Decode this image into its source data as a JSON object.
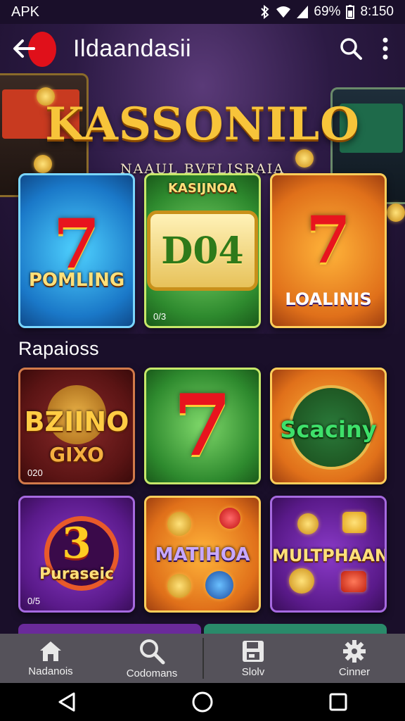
{
  "status_bar": {
    "left_text": "APK",
    "battery": "69%",
    "time": "8:150"
  },
  "app_bar": {
    "title": "Ildaandasii",
    "back_icon": "arrow-left-icon",
    "search_icon": "search-icon",
    "menu_icon": "more-vert-icon"
  },
  "hero": {
    "title": "KASSONILO",
    "subtitle": "NAAUL BVFLISRAIA"
  },
  "featured": [
    {
      "big": "7",
      "label": "POMLING",
      "small": "",
      "theme": "blue"
    },
    {
      "big": "D04",
      "label": "KASIJNOA",
      "small": "0/3",
      "theme": "green"
    },
    {
      "big": "7",
      "label": "LOALINIS",
      "small": "",
      "theme": "orange"
    }
  ],
  "section": {
    "title": "Rapaioss"
  },
  "games": [
    {
      "big": "BZIINO",
      "label": "GIXO",
      "small": "020",
      "theme": "maroon"
    },
    {
      "big": "7",
      "label": "",
      "small": "",
      "theme": "green"
    },
    {
      "big": "",
      "label": "Scaciny",
      "small": "",
      "theme": "orange"
    },
    {
      "big": "3",
      "label": "Puraseic",
      "small": "0/5",
      "theme": "purple"
    },
    {
      "big": "",
      "label": "MATIHOA",
      "small": "",
      "theme": "orange"
    },
    {
      "big": "",
      "label": "MULTPHAAN",
      "small": "",
      "theme": "purple"
    }
  ],
  "bottom_nav": [
    {
      "label": "Nadanois",
      "icon": "home-icon"
    },
    {
      "label": "Codomans",
      "icon": "search-icon"
    },
    {
      "label": "Slolv",
      "icon": "save-icon"
    },
    {
      "label": "Cinner",
      "icon": "gear-icon"
    }
  ],
  "system_nav": {
    "back": "triangle-back-icon",
    "home": "circle-home-icon",
    "recents": "square-recents-icon"
  },
  "colors": {
    "accent_gold": "#f7c43a",
    "back_red": "#e0101a",
    "nav_bg": "#55525a"
  }
}
